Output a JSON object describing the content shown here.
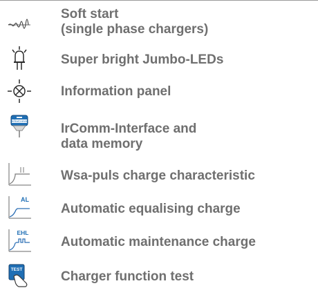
{
  "features": [
    {
      "icon": "soft-start-waveform-icon",
      "lines": [
        "Soft start",
        "(single phase chargers)"
      ]
    },
    {
      "icon": "led-icon",
      "lines": [
        "Super bright Jumbo-LEDs"
      ]
    },
    {
      "icon": "indicator-lamp-icon",
      "lines": [
        "Information panel"
      ]
    },
    {
      "icon": "ircomm-module-icon",
      "icon_text": "InfraComm",
      "lines": [
        "IrComm-Interface and",
        "data memory"
      ]
    },
    {
      "icon": "wsa-curve-icon",
      "lines": [
        "Wsa-puls charge characteristic"
      ]
    },
    {
      "icon": "al-curve-icon",
      "icon_text": "AL",
      "lines": [
        "Automatic equalising charge"
      ]
    },
    {
      "icon": "ehl-curve-icon",
      "icon_text": "EHL",
      "lines": [
        "Automatic maintenance charge"
      ]
    },
    {
      "icon": "test-button-icon",
      "icon_text": "TEST",
      "lines": [
        "Charger function test"
      ]
    }
  ],
  "colors": {
    "label_text": "#6f6f6f",
    "icon_stroke": "#4a4a4a",
    "accent_blue": "#1f6fb5",
    "curve_blue": "#2a6db4"
  }
}
